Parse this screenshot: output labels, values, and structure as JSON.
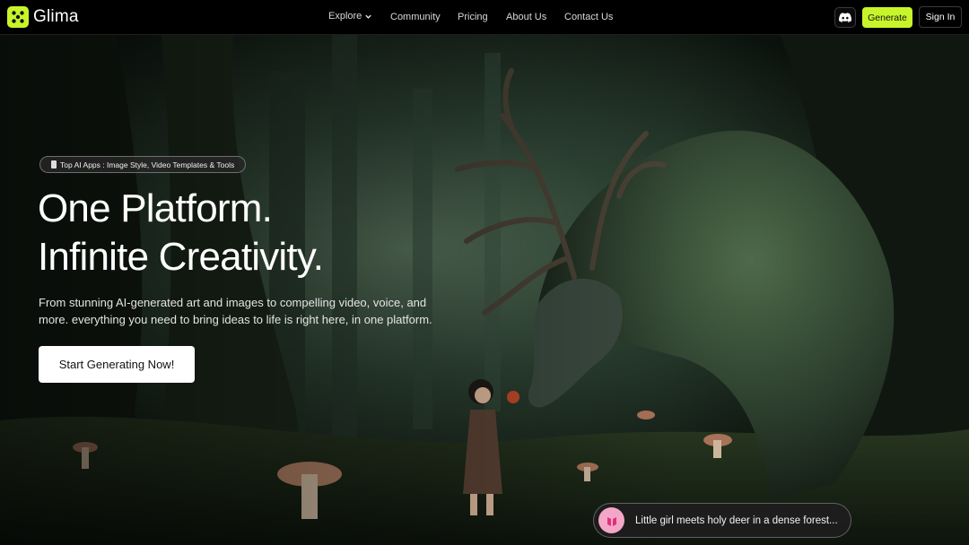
{
  "brand": {
    "name": "Glima",
    "accent": "#c8f52a"
  },
  "nav": {
    "items": [
      {
        "label": "Explore",
        "has_dropdown": true
      },
      {
        "label": "Community"
      },
      {
        "label": "Pricing"
      },
      {
        "label": "About Us"
      },
      {
        "label": "Contact Us"
      }
    ]
  },
  "header_actions": {
    "discord_icon": "discord-icon",
    "generate_label": "Generate",
    "signin_label": "Sign In"
  },
  "hero": {
    "badge": "Top AI Apps : Image Style, Video Templates & Tools",
    "headline_line1": "One Platform.",
    "headline_line2": "Infinite Creativity.",
    "subtext": "From stunning AI-generated art and images to compelling video, voice, and more. everything you need to bring ideas to life is right here, in one platform.",
    "cta_label": "Start Generating Now!",
    "prompt_text": "Little girl meets holy deer in a dense forest..."
  }
}
